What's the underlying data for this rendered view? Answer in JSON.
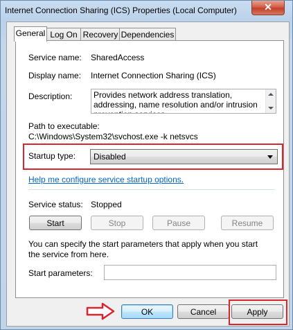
{
  "window": {
    "title": "Internet Connection Sharing (ICS) Properties (Local Computer)",
    "close_glyph": "✕"
  },
  "tabs": [
    {
      "label": "General",
      "active": true
    },
    {
      "label": "Log On",
      "active": false
    },
    {
      "label": "Recovery",
      "active": false
    },
    {
      "label": "Dependencies",
      "active": false
    }
  ],
  "general": {
    "service_name_label": "Service name:",
    "service_name_value": "SharedAccess",
    "display_name_label": "Display name:",
    "display_name_value": "Internet Connection Sharing (ICS)",
    "description_label": "Description:",
    "description_value": "Provides network address translation, addressing, name resolution and/or intrusion prevention services",
    "path_label": "Path to executable:",
    "path_value": "C:\\Windows\\System32\\svchost.exe -k netsvcs",
    "startup_type_label": "Startup type:",
    "startup_type_value": "Disabled",
    "help_link": "Help me configure service startup options.",
    "service_status_label": "Service status:",
    "service_status_value": "Stopped",
    "buttons": {
      "start": "Start",
      "stop": "Stop",
      "pause": "Pause",
      "resume": "Resume"
    },
    "start_params_info": "You can specify the start parameters that apply when you start the service from here.",
    "start_params_label": "Start parameters:",
    "start_params_value": ""
  },
  "footer": {
    "ok": "OK",
    "cancel": "Cancel",
    "apply": "Apply"
  },
  "highlight_color": "#d9252e",
  "icons": [
    "close-icon",
    "dropdown-arrow-icon",
    "right-arrow-icon",
    "scroll-up-icon",
    "scroll-down-icon"
  ]
}
